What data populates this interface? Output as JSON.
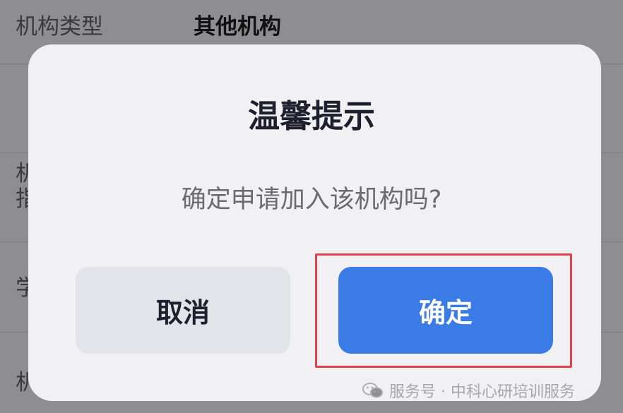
{
  "background_form": {
    "rows": [
      {
        "label": "机构类型",
        "value": "其他机构"
      },
      {
        "label": "机",
        "value": ""
      },
      {
        "label": "指",
        "value": ""
      },
      {
        "label": "学",
        "value": ""
      },
      {
        "label": "机",
        "value": ""
      }
    ]
  },
  "dialog": {
    "title": "温馨提示",
    "message": "确定申请加入该机构吗?",
    "cancel_label": "取消",
    "confirm_label": "确定"
  },
  "watermark": {
    "text": "服务号 · 中科心研培训服务"
  },
  "colors": {
    "confirm_button": "#3a7be6",
    "highlight_box": "#e0414a",
    "dialog_bg": "#f1f1f3"
  }
}
